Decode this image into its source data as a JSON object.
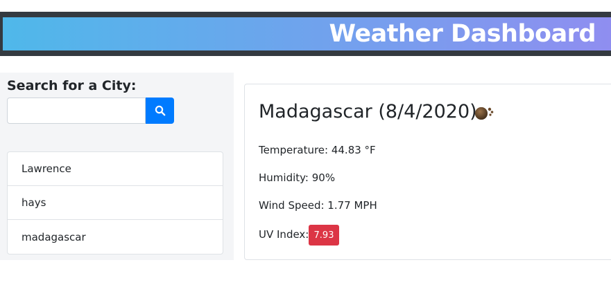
{
  "header": {
    "title": "Weather Dashboard"
  },
  "search": {
    "label": "Search for a City:",
    "value": "",
    "placeholder": ""
  },
  "history": [
    "Lawrence",
    "hays",
    "madagascar"
  ],
  "current": {
    "title": "Madagascar (8/4/2020)",
    "icon": "rain-cloud-icon",
    "temperature": "Temperature: 44.83 °F",
    "humidity": "Humidity: 90%",
    "wind": "Wind Speed: 1.77 MPH",
    "uv_label": "UV Index:",
    "uv_value": "7.93"
  },
  "colors": {
    "header_bg": "#343a40",
    "gradient_start": "#4fb8ea",
    "gradient_end": "#8f8ef0",
    "button": "#007bff",
    "uv_badge": "#dc3545"
  }
}
